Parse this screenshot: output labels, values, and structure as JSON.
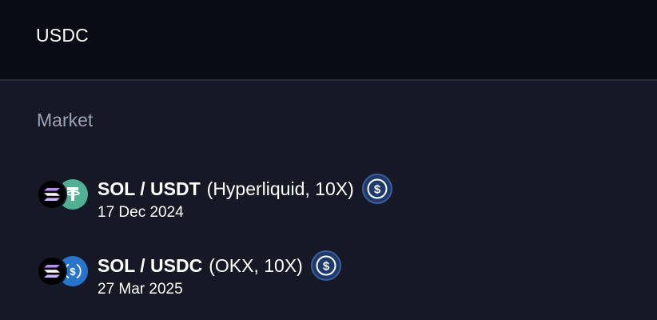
{
  "header": {
    "title": "USDC"
  },
  "section": {
    "label": "Market"
  },
  "markets": [
    {
      "pair": "SOL / USDT",
      "meta": "(Hyperliquid, 10X)",
      "date": "17 Dec 2024",
      "base_icon": "solana-icon",
      "quote_icon": "tether-icon",
      "badge_icon": "usdc-icon"
    },
    {
      "pair": "SOL / USDC",
      "meta": "(OKX, 10X)",
      "date": "27 Mar 2025",
      "base_icon": "solana-icon",
      "quote_icon": "usdc-icon",
      "badge_icon": "usdc-icon"
    }
  ],
  "colors": {
    "background": "#161925",
    "header_background": "#0a0c15",
    "usdt_green": "#50af95",
    "usdc_blue": "#2775ca",
    "muted_text": "#9ba3b6"
  }
}
